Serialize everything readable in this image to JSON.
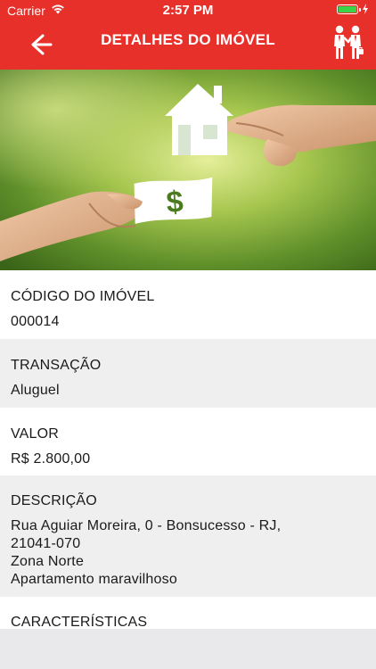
{
  "status_bar": {
    "carrier": "Carrier",
    "time": "2:57 PM",
    "battery_level": 1.0
  },
  "nav": {
    "title": "DETALHES DO IMÓVEL",
    "back_icon": "arrow-left-icon",
    "agent_icon": "handshake-icon"
  },
  "hero": {
    "banknote_symbol": "$"
  },
  "details": {
    "codigo": {
      "label": "CÓDIGO DO IMÓVEL",
      "value": "000014"
    },
    "transacao": {
      "label": "TRANSAÇÃO",
      "value": "Aluguel"
    },
    "valor": {
      "label": "VALOR",
      "value": "R$ 2.800,00"
    },
    "descricao": {
      "label": "DESCRIÇÃO",
      "lines": [
        "Rua Aguiar Moreira, 0 - Bonsucesso - RJ,",
        "21041-070",
        "Zona Norte",
        "Apartamento maravilhoso"
      ]
    },
    "caracteristicas": {
      "label": "CARACTERÍSTICAS"
    }
  },
  "colors": {
    "header": "#e8302b",
    "row_white": "#ffffff",
    "row_grey": "#efefef",
    "battery_green": "#3bd34a"
  }
}
